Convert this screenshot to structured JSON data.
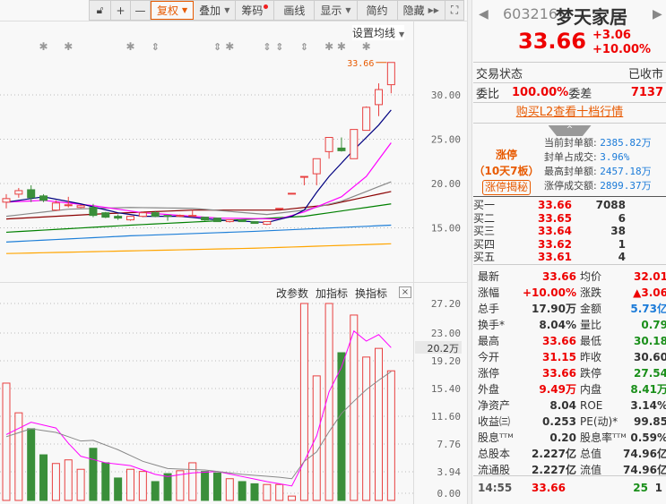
{
  "toolbar": {
    "lock_icon": "unlock-icon",
    "plus": "+",
    "minus": "—",
    "fuquan": "复权",
    "diejia": "叠加",
    "chouma": "筹码",
    "huaxian": "画线",
    "xianshi": "显示",
    "jianyue": "简约",
    "yincang": "隐藏",
    "hide_icon": "double-play-icon",
    "fullscreen_icon": "fullscreen-icon"
  },
  "main": {
    "set_ma_label": "设置均线",
    "last_price_label": "33.66",
    "price_ticks": [
      "30.00",
      "25.00",
      "20.00",
      "15.00"
    ],
    "markers": [
      {
        "i": 3,
        "type": "star"
      },
      {
        "i": 5,
        "type": "star"
      },
      {
        "i": 10,
        "type": "star"
      },
      {
        "i": 12,
        "type": "bar"
      },
      {
        "i": 17,
        "type": "bar"
      },
      {
        "i": 18,
        "type": "star"
      },
      {
        "i": 21,
        "type": "bar"
      },
      {
        "i": 22,
        "type": "bar"
      },
      {
        "i": 24,
        "type": "bar"
      },
      {
        "i": 26,
        "type": "star"
      },
      {
        "i": 27,
        "type": "star"
      },
      {
        "i": 29,
        "type": "star"
      }
    ]
  },
  "volume": {
    "tools": [
      "改参数",
      "加指标",
      "换指标"
    ],
    "close_label": "×",
    "current_label": "20.2万",
    "ticks": [
      "27.20",
      "23.00",
      "19.20",
      "15.40",
      "11.60",
      "7.76",
      "3.94",
      "0.00"
    ],
    "tick_values": [
      27.2,
      23.0,
      19.2,
      15.4,
      11.6,
      7.76,
      3.94,
      0.0
    ]
  },
  "colors": {
    "up": "#e84040",
    "down": "#3a8f3a",
    "ma5": "#000080",
    "ma10": "#ff00ff",
    "ma20": "#888888",
    "ma30": "#8b0000",
    "ma60": "#008000",
    "ma120": "#1e7fd8",
    "ma250": "#ffa500"
  },
  "chart_data": {
    "type": "candlestick",
    "price_range": [
      10.5,
      35
    ],
    "candles": [
      [
        17.9,
        18.8,
        17.2,
        18.3
      ],
      [
        18.8,
        19.5,
        18.4,
        19.2
      ],
      [
        19.3,
        19.8,
        17.9,
        18.4
      ],
      [
        18.6,
        18.8,
        17.9,
        18.1
      ],
      [
        17.0,
        18.1,
        16.9,
        17.8
      ],
      [
        17.5,
        18.5,
        17.3,
        17.6
      ],
      [
        17.3,
        17.6,
        17.2,
        17.5
      ],
      [
        17.3,
        17.7,
        16.2,
        16.4
      ],
      [
        16.7,
        16.8,
        16.1,
        16.2
      ],
      [
        16.3,
        16.5,
        15.9,
        16.1
      ],
      [
        15.9,
        16.3,
        15.8,
        16.3
      ],
      [
        16.3,
        16.8,
        16.2,
        16.7
      ],
      [
        16.7,
        16.9,
        16.2,
        16.3
      ],
      [
        16.4,
        16.4,
        15.8,
        16.3
      ],
      [
        16.3,
        16.5,
        16.2,
        16.4
      ],
      [
        16.4,
        17.0,
        16.3,
        16.4
      ],
      [
        16.2,
        16.2,
        15.8,
        15.9
      ],
      [
        16.1,
        16.1,
        15.7,
        15.7
      ],
      [
        15.7,
        15.9,
        15.6,
        15.9
      ],
      [
        15.9,
        15.9,
        15.7,
        15.7
      ],
      [
        15.7,
        15.7,
        15.5,
        15.5
      ],
      [
        15.4,
        15.7,
        15.3,
        15.7
      ],
      [
        17.2,
        17.2,
        17.2,
        17.2
      ],
      [
        18.9,
        18.9,
        18.9,
        18.9
      ],
      [
        20.8,
        20.8,
        19.8,
        20.8
      ],
      [
        21.1,
        22.8,
        19.8,
        22.8
      ],
      [
        23.6,
        25.2,
        22.8,
        25.2
      ],
      [
        24.0,
        25.2,
        23.6,
        23.7
      ],
      [
        22.8,
        26.1,
        22.8,
        26.1
      ],
      [
        26.0,
        28.7,
        26.0,
        28.6
      ],
      [
        28.9,
        31.3,
        27.6,
        30.6
      ],
      [
        31.15,
        33.66,
        30.18,
        33.66
      ]
    ],
    "ma_lines": [
      {
        "name": "MA5",
        "color_key": "ma5",
        "points": [
          [
            0,
            17.9
          ],
          [
            3,
            18.5
          ],
          [
            6,
            17.7
          ],
          [
            9,
            16.7
          ],
          [
            11,
            16.3
          ],
          [
            14,
            16.3
          ],
          [
            17,
            15.9
          ],
          [
            21,
            15.6
          ],
          [
            23,
            16.3
          ],
          [
            24,
            17.0
          ],
          [
            25,
            19.0
          ],
          [
            26,
            20.8
          ],
          [
            28,
            23.8
          ],
          [
            30,
            26.6
          ],
          [
            31,
            28.3
          ]
        ]
      },
      {
        "name": "MA10",
        "color_key": "ma10",
        "points": [
          [
            0,
            17.9
          ],
          [
            3,
            18.1
          ],
          [
            7,
            17.5
          ],
          [
            11,
            16.7
          ],
          [
            17,
            16.1
          ],
          [
            22,
            16.0
          ],
          [
            24,
            16.8
          ],
          [
            27,
            18.5
          ],
          [
            29,
            20.8
          ],
          [
            31,
            24.6
          ]
        ]
      },
      {
        "name": "MA20",
        "color_key": "ma20",
        "points": [
          [
            0,
            16.3
          ],
          [
            5,
            17.1
          ],
          [
            10,
            17.3
          ],
          [
            15,
            17.2
          ],
          [
            21,
            16.5
          ],
          [
            24,
            17.0
          ],
          [
            27,
            18.0
          ],
          [
            31,
            20.2
          ]
        ]
      },
      {
        "name": "MA30",
        "color_key": "ma30",
        "points": [
          [
            0,
            16.0
          ],
          [
            8,
            16.6
          ],
          [
            15,
            17.0
          ],
          [
            22,
            17.0
          ],
          [
            26,
            17.6
          ],
          [
            31,
            19.1
          ]
        ]
      },
      {
        "name": "MA60",
        "color_key": "ma60",
        "points": [
          [
            0,
            14.5
          ],
          [
            10,
            15.3
          ],
          [
            20,
            16.0
          ],
          [
            24,
            16.3
          ],
          [
            31,
            17.7
          ]
        ]
      },
      {
        "name": "MA120",
        "color_key": "ma120",
        "points": [
          [
            0,
            13.4
          ],
          [
            10,
            14.1
          ],
          [
            20,
            14.6
          ],
          [
            31,
            15.3
          ]
        ]
      },
      {
        "name": "MA250",
        "color_key": "ma250",
        "points": [
          [
            0,
            12.1
          ],
          [
            10,
            12.4
          ],
          [
            20,
            12.7
          ],
          [
            31,
            13.2
          ]
        ]
      }
    ],
    "volume_unit": "万",
    "volume_range": [
      0,
      27.2
    ],
    "volumes": [
      16.2,
      12.1,
      9.9,
      6.3,
      5.1,
      5.6,
      4.3,
      7.2,
      5.2,
      3.1,
      4.3,
      4.0,
      2.6,
      3.7,
      4.1,
      5.2,
      4.0,
      3.8,
      3.0,
      2.6,
      2.3,
      2.2,
      2.2,
      0.6,
      27.2,
      17.2,
      27.2,
      20.4,
      25.6,
      19.8,
      21.0,
      17.9
    ],
    "volume_ma": [
      {
        "name": "VMA5",
        "color_key": "ma10",
        "points": [
          [
            0,
            9.1
          ],
          [
            2,
            10.8
          ],
          [
            4,
            10.0
          ],
          [
            5,
            7.9
          ],
          [
            6,
            6.1
          ],
          [
            8,
            5.2
          ],
          [
            10,
            4.8
          ],
          [
            12,
            3.6
          ],
          [
            13,
            3.3
          ],
          [
            15,
            3.8
          ],
          [
            17,
            4.0
          ],
          [
            19,
            3.3
          ],
          [
            21,
            2.6
          ],
          [
            23,
            2.0
          ],
          [
            24,
            5.4
          ],
          [
            25,
            8.9
          ],
          [
            26,
            15.0
          ],
          [
            27,
            18.4
          ],
          [
            28,
            23.4
          ],
          [
            29,
            22.0
          ],
          [
            30,
            22.9
          ],
          [
            31,
            21.1
          ]
        ]
      },
      {
        "name": "VMA10",
        "color_key": "ma20",
        "points": [
          [
            0,
            8.8
          ],
          [
            2,
            9.9
          ],
          [
            4,
            9.4
          ],
          [
            6,
            8.2
          ],
          [
            7,
            8.3
          ],
          [
            9,
            7.0
          ],
          [
            11,
            5.4
          ],
          [
            13,
            4.4
          ],
          [
            16,
            4.2
          ],
          [
            19,
            3.6
          ],
          [
            22,
            3.2
          ],
          [
            23,
            3.0
          ],
          [
            24,
            5.4
          ],
          [
            25,
            6.7
          ],
          [
            26,
            9.5
          ],
          [
            27,
            12.0
          ],
          [
            28,
            13.7
          ],
          [
            29,
            15.3
          ],
          [
            30,
            16.6
          ],
          [
            31,
            17.8
          ]
        ]
      }
    ]
  },
  "quote": {
    "code": "603216",
    "name": "梦天家居",
    "price": "33.66",
    "change": "+3.06",
    "change_pct": "+10.00%",
    "status_label": "交易状态",
    "status_value": "已收市",
    "wb_label": "委比",
    "wb_value": "100.00%",
    "wc_label": "委差",
    "wc_value": "7137",
    "l2_link": "购买L2查看十档行情",
    "collapse": "^",
    "limit": {
      "title": "涨停",
      "sub": "（10天7板）",
      "button": "涨停揭秘",
      "rows": [
        {
          "label": "当前封单额:",
          "value": "2385.82万"
        },
        {
          "label": "封单占成交:",
          "value": "3.96%"
        },
        {
          "label": "最高封单额:",
          "value": "2457.18万"
        },
        {
          "label": "涨停成交额:",
          "value": "2899.37万"
        }
      ]
    },
    "bids": [
      {
        "label": "买一",
        "price": "33.66",
        "qty": "7088"
      },
      {
        "label": "买二",
        "price": "33.65",
        "qty": "6"
      },
      {
        "label": "买三",
        "price": "33.64",
        "qty": "38"
      },
      {
        "label": "买四",
        "price": "33.62",
        "qty": "1"
      },
      {
        "label": "买五",
        "price": "33.61",
        "qty": "4"
      }
    ],
    "stats": [
      {
        "l1": "最新",
        "v1": "33.66",
        "c1": "red",
        "l2": "均价",
        "v2": "32.01",
        "c2": "red"
      },
      {
        "l1": "涨幅",
        "v1": "+10.00%",
        "c1": "red",
        "l2": "涨跌",
        "v2": "▲3.06",
        "c2": "red"
      },
      {
        "l1": "总手",
        "v1": "17.90万",
        "c1": "dark",
        "l2": "金额",
        "v2": "5.73亿",
        "c2": "blue"
      },
      {
        "l1": "换手*",
        "v1": "8.04%",
        "c1": "dark",
        "l2": "量比",
        "v2": "0.79",
        "c2": "green"
      },
      {
        "l1": "最高",
        "v1": "33.66",
        "c1": "red",
        "l2": "最低",
        "v2": "30.18",
        "c2": "green"
      },
      {
        "l1": "今开",
        "v1": "31.15",
        "c1": "red",
        "l2": "昨收",
        "v2": "30.60",
        "c2": "dark"
      },
      {
        "l1": "涨停",
        "v1": "33.66",
        "c1": "red",
        "l2": "跌停",
        "v2": "27.54",
        "c2": "green"
      },
      {
        "l1": "外盘",
        "v1": "9.49万",
        "c1": "red",
        "l2": "内盘",
        "v2": "8.41万",
        "c2": "green"
      },
      {
        "l1": "净资产",
        "v1": "8.04",
        "c1": "dark",
        "l2": "ROE",
        "v2": "3.14%",
        "c2": "dark"
      },
      {
        "l1": "收益㈢",
        "v1": "0.253",
        "c1": "dark",
        "l2": "PE(动)*",
        "v2": "99.85",
        "c2": "dark"
      },
      {
        "l1": "股息ᵀᵀᴹ",
        "v1": "0.20",
        "c1": "dark",
        "l2": "股息率ᵀᵀᴹ",
        "v2": "0.59%",
        "c2": "dark"
      },
      {
        "l1": "总股本",
        "v1": "2.227亿",
        "c1": "dark",
        "l2": "总值",
        "v2": "74.96亿",
        "c2": "dark"
      },
      {
        "l1": "流通股",
        "v1": "2.227亿",
        "c1": "dark",
        "l2": "流值",
        "v2": "74.96亿",
        "c2": "dark"
      }
    ],
    "last_tick": {
      "time": "14:55",
      "price": "33.66",
      "qty": "25",
      "count": "1"
    }
  }
}
